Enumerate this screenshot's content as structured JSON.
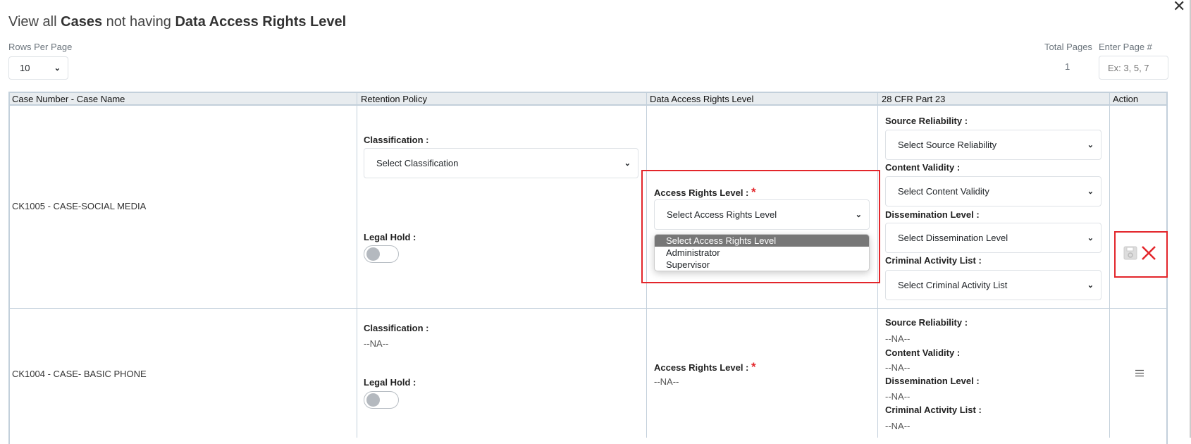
{
  "title": {
    "prefix": "View all ",
    "entity": "Cases",
    "middle": " not having ",
    "field": "Data Access Rights Level"
  },
  "pagination": {
    "rows_per_page_label": "Rows Per Page",
    "rows_per_page": "10",
    "total_pages_label": "Total Pages",
    "total_pages": "1",
    "enter_page_label": "Enter Page #",
    "enter_page_placeholder": "Ex: 3, 5, 7"
  },
  "columns": [
    "Case Number - Case Name",
    "Retention Policy",
    "Data Access Rights Level",
    "28 CFR Part 23",
    "Action"
  ],
  "labels": {
    "classification": "Classification :",
    "legal_hold": "Legal Hold :",
    "access_rights": "Access Rights Level :",
    "required": "*",
    "source_reliability": "Source Reliability :",
    "content_validity": "Content Validity :",
    "dissemination": "Dissemination Level :",
    "criminal_activity": "Criminal Activity List :"
  },
  "rows": [
    {
      "case": "CK1005 - CASE-SOCIAL MEDIA",
      "classification": "Select Classification",
      "legal_hold": false,
      "access_rights": "Select Access Rights Level",
      "access_rights_options": [
        "Select Access Rights Level",
        "Administrator",
        "Supervisor"
      ],
      "source_reliability": "Select Source Reliability",
      "content_validity": "Select Content Validity",
      "dissemination": "Select Dissemination Level",
      "criminal_activity": "Select Criminal Activity List"
    },
    {
      "case": "CK1004 - CASE- BASIC PHONE",
      "classification": "--NA--",
      "legal_hold": false,
      "access_rights": "--NA--",
      "source_reliability": "--NA--",
      "content_validity": "--NA--",
      "dissemination": "--NA--",
      "criminal_activity": "--NA--"
    }
  ],
  "colors": {
    "highlight": "#e3262b",
    "header_bg": "#e8ecef"
  }
}
